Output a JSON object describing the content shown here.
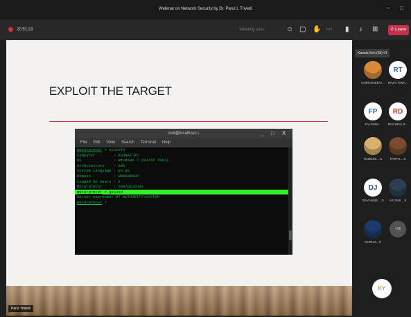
{
  "window": {
    "title": "Webinar on Network Security by Dr. Parul I. Trivedi",
    "controls": [
      "–",
      "□"
    ]
  },
  "toolbar": {
    "timer": "20:51:23",
    "aux_label": "Meeting chat",
    "leave_label": "Leave"
  },
  "slide": {
    "title": "EXPLOIT THE TARGET"
  },
  "terminal": {
    "title": "root@localhost:~",
    "controls": [
      "_",
      "□",
      "X"
    ],
    "menu": [
      "File",
      "Edit",
      "View",
      "Search",
      "Terminal",
      "Help"
    ],
    "lines": [
      {
        "prompt": "meterpreter",
        "text": " > sysinfo",
        "highlight": false
      },
      {
        "prompt": "",
        "text": "Computer        : KUDRAT-PC",
        "highlight": false
      },
      {
        "prompt": "",
        "text": "OS              : Windows 7 (Build 7601).",
        "highlight": false
      },
      {
        "prompt": "",
        "text": "Architecture    : x86",
        "highlight": false
      },
      {
        "prompt": "",
        "text": "System Language : en_US",
        "highlight": false
      },
      {
        "prompt": "",
        "text": "Domain          : WORKGROUP",
        "highlight": false
      },
      {
        "prompt": "",
        "text": "Logged On Users : 2",
        "highlight": false
      },
      {
        "prompt": "",
        "text": "Meterpreter     : x86/windows",
        "highlight": false
      },
      {
        "prompt": "meterpreter",
        "text": " > getuid",
        "highlight": true
      },
      {
        "prompt": "",
        "text": "Server username: NT AUTHORITY\\SYSTEM",
        "highlight": false
      },
      {
        "prompt": "meterpreter",
        "text": " > ",
        "highlight": false
      }
    ]
  },
  "presenter_label": "Parul Trivedi",
  "tooltip": "Kanula Kirti (Sli)-VI",
  "participants": [
    {
      "initials": "",
      "label": "CHIRANJEEVI...",
      "bg": "#d88a3c",
      "fg": "#ffffff"
    },
    {
      "initials": "RT",
      "label": "RAJIV TIWA...",
      "bg": "#ffffff",
      "fg": "#2b6cb0"
    },
    {
      "initials": "FP",
      "label": "FALGUNI...  ",
      "bg": "#ffffff",
      "fg": "#2f6fa7"
    },
    {
      "initials": "RD",
      "label": "RUCHIKA D...",
      "bg": "#ffffff",
      "fg": "#c0392b"
    },
    {
      "initials": "",
      "label": "NANDINI... S",
      "bg": "#d9b16a",
      "fg": "#ffffff"
    },
    {
      "initials": "",
      "label": "PARTH... S",
      "bg": "#7a4b2f",
      "fg": "#ffffff"
    },
    {
      "initials": "DJ",
      "label": "DEVANSHI... S",
      "bg": "#ffffff",
      "fg": "#2b4c8c"
    },
    {
      "initials": "",
      "label": "AYUSHI... S",
      "bg": "#2c3e50",
      "fg": "#ffffff"
    },
    {
      "initials": "",
      "label": "DHRUV... S",
      "bg": "#1a3a6b",
      "fg": "#ffffff"
    }
  ],
  "more_label": "+16",
  "self_initials": "KY",
  "colors": {
    "leave": "#c4314b",
    "terminal_text": "#1fb24d",
    "terminal_highlight": "#35f12c",
    "slide_rule": "#cc3333"
  },
  "icons": [
    "record-dot-icon",
    "people-icon",
    "chat-icon",
    "hand-icon",
    "more-icon",
    "camera-icon",
    "mic-icon",
    "share-icon"
  ]
}
